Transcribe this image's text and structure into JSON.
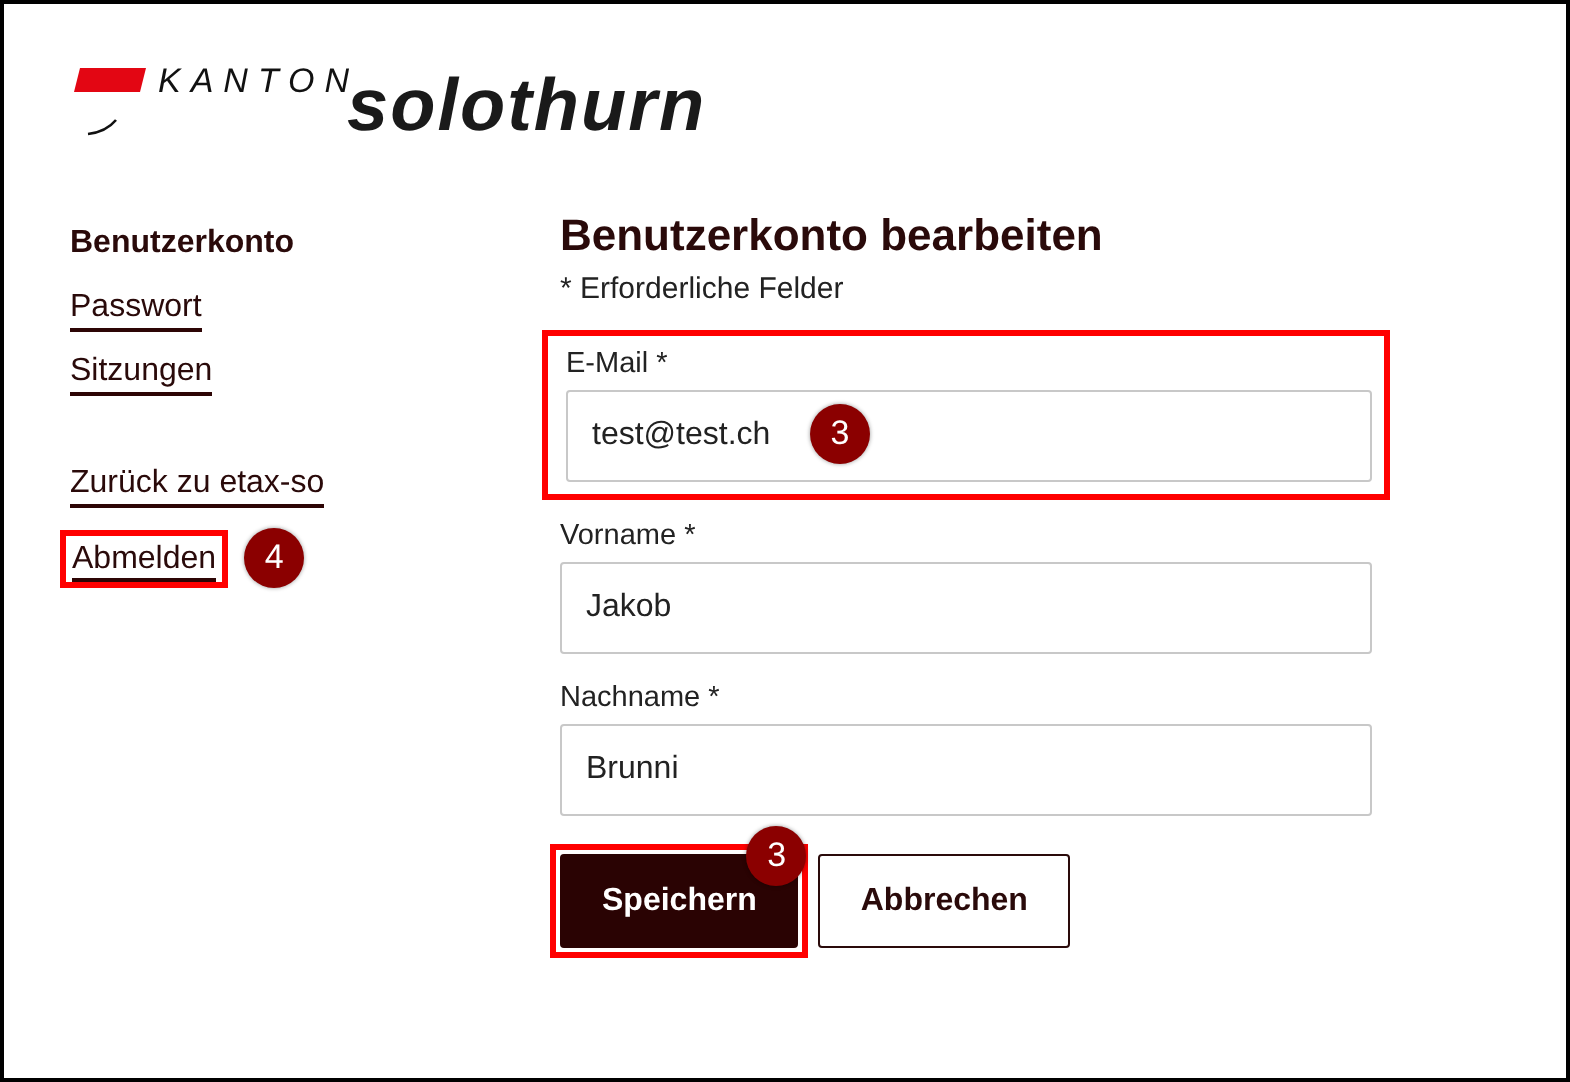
{
  "logo": {
    "prefix": "KANTON",
    "name": "solothurn"
  },
  "sidebar": {
    "items": [
      {
        "label": "Benutzerkonto",
        "selected": true
      },
      {
        "label": "Passwort",
        "selected": false
      },
      {
        "label": "Sitzungen",
        "selected": false
      }
    ],
    "footer_items": [
      {
        "label": "Zurück zu etax-so",
        "highlighted": false
      },
      {
        "label": "Abmelden",
        "highlighted": true,
        "badge": "4"
      }
    ]
  },
  "heading": "Benutzerkonto bearbeiten",
  "required_note": "* Erforderliche Felder",
  "fields": [
    {
      "label": "E-Mail *",
      "value": "test@test.ch",
      "highlighted": true,
      "badge": "3"
    },
    {
      "label": "Vorname *",
      "value": "Jakob",
      "highlighted": false
    },
    {
      "label": "Nachname *",
      "value": "Brunni",
      "highlighted": false
    }
  ],
  "buttons": [
    {
      "label": "Speichern",
      "kind": "primary",
      "highlighted": true,
      "badge": "3"
    },
    {
      "label": "Abbrechen",
      "kind": "secondary",
      "highlighted": false
    }
  ]
}
